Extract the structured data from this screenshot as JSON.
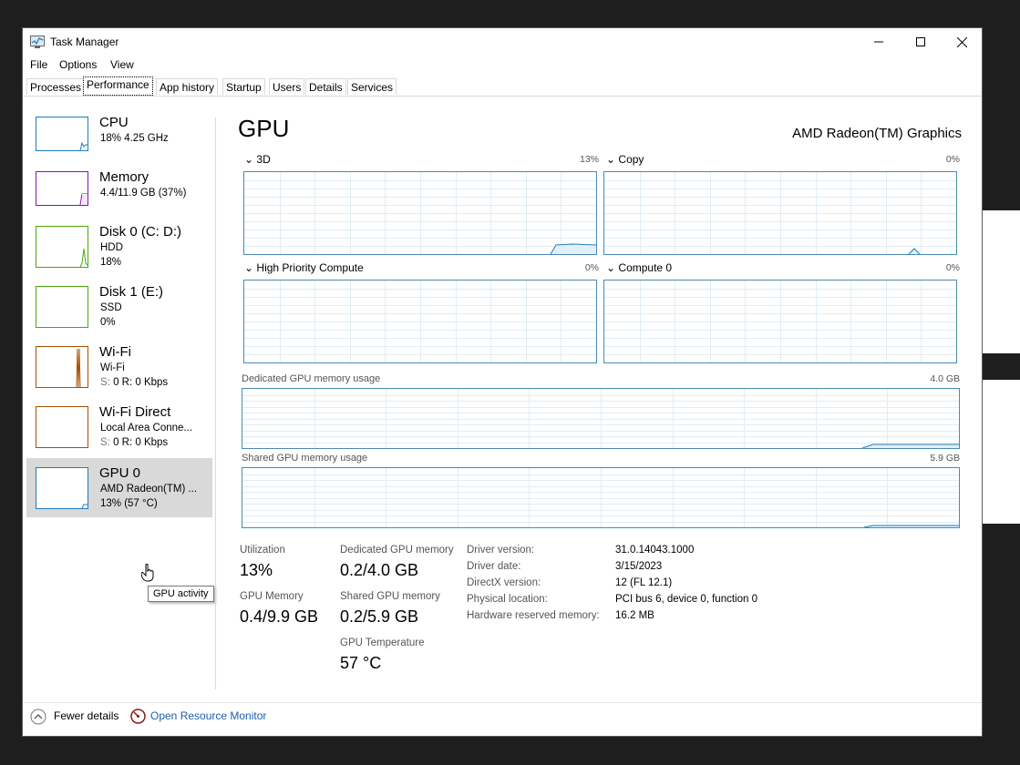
{
  "window": {
    "title": "Task Manager"
  },
  "menu": {
    "file": "File",
    "options": "Options",
    "view": "View"
  },
  "tabs": [
    "Processes",
    "Performance",
    "App history",
    "Startup",
    "Users",
    "Details",
    "Services"
  ],
  "sidebar": [
    {
      "name": "CPU",
      "line2": "18% 4.25 GHz",
      "line3": "",
      "color": "#1c7dbf"
    },
    {
      "name": "Memory",
      "line2": "4.4/11.9 GB (37%)",
      "line3": "",
      "color": "#8b12ae"
    },
    {
      "name": "Disk 0 (C: D:)",
      "line2": "HDD",
      "line3": "18%",
      "color": "#4da60c"
    },
    {
      "name": "Disk 1 (E:)",
      "line2": "SSD",
      "line3": "0%",
      "color": "#4da60c"
    },
    {
      "name": "Wi-Fi",
      "line2": "Wi-Fi",
      "line3_s": "S:",
      "line3": "0 R: 0 Kbps",
      "color": "#a74f01"
    },
    {
      "name": "Wi-Fi Direct",
      "line2": "Local Area Conne...",
      "line3_s": "S:",
      "line3": "0 R: 0 Kbps",
      "color": "#a74f01"
    },
    {
      "name": "GPU 0",
      "line2": "AMD Radeon(TM) ...",
      "line3": "13% (57 °C)",
      "color": "#1c7dbf"
    }
  ],
  "tooltip": "GPU activity",
  "main": {
    "heading": "GPU",
    "device": "AMD Radeon(TM) Graphics",
    "engines": [
      {
        "label": "3D",
        "pct": "13%"
      },
      {
        "label": "Copy",
        "pct": "0%"
      },
      {
        "label": "High Priority Compute",
        "pct": "0%"
      },
      {
        "label": "Compute 0",
        "pct": "0%"
      }
    ],
    "dedicated": {
      "label": "Dedicated GPU memory usage",
      "max": "4.0 GB"
    },
    "shared": {
      "label": "Shared GPU memory usage",
      "max": "5.9 GB"
    },
    "stats": {
      "utilization_label": "Utilization",
      "utilization": "13%",
      "dedicated_label": "Dedicated GPU memory",
      "dedicated": "0.2/4.0 GB",
      "gpumem_label": "GPU Memory",
      "gpumem": "0.4/9.9 GB",
      "shared_label": "Shared GPU memory",
      "shared": "0.2/5.9 GB",
      "temp_label": "GPU Temperature",
      "temp": "57 °C"
    },
    "info": [
      {
        "k": "Driver version:",
        "v": "31.0.14043.1000"
      },
      {
        "k": "Driver date:",
        "v": "3/15/2023"
      },
      {
        "k": "DirectX version:",
        "v": "12 (FL 12.1)"
      },
      {
        "k": "Physical location:",
        "v": "PCI bus 6, device 0, function 0"
      },
      {
        "k": "Hardware reserved memory:",
        "v": "16.2 MB"
      }
    ]
  },
  "footer": {
    "fewer": "Fewer details",
    "monitor": "Open Resource Monitor"
  },
  "colors": {
    "graph_border": "#4a8ab2",
    "graph_line": "#1c7dbf",
    "grid": "#e1ecf4"
  }
}
